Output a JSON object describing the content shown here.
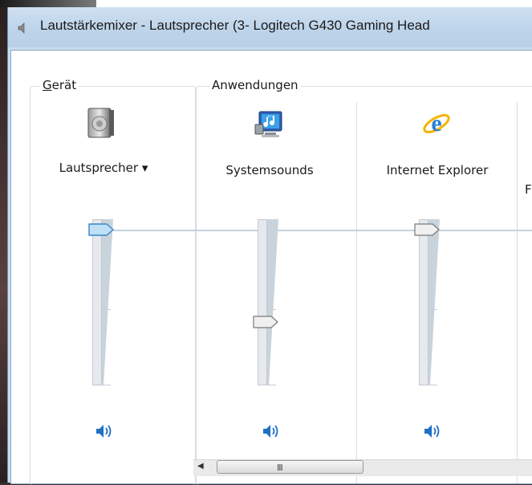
{
  "window": {
    "title": "Lautstärkemixer - Lautsprecher (3- Logitech G430 Gaming Head"
  },
  "groups": {
    "device_label_underlined": "G",
    "device_label_rest": "erät",
    "apps_label": "Anwendungen"
  },
  "device": {
    "name": "Lautsprecher",
    "dropdown_glyph": "▾",
    "icon": "speaker-device-icon",
    "volume": 1.0,
    "muted": false
  },
  "apps": [
    {
      "name": "Systemsounds",
      "icon": "system-sounds-icon",
      "volume": 0.43,
      "muted": false
    },
    {
      "name": "Internet Explorer",
      "icon": "internet-explorer-icon",
      "volume": 1.0,
      "muted": false
    }
  ],
  "partial_label": "F",
  "scrollbar": {
    "grip": "III",
    "left_arrow": "◀"
  },
  "colors": {
    "titlebar": "#c9dced",
    "accent_blue": "#1f6fc5",
    "thumb_active": "#bfe0f7"
  }
}
